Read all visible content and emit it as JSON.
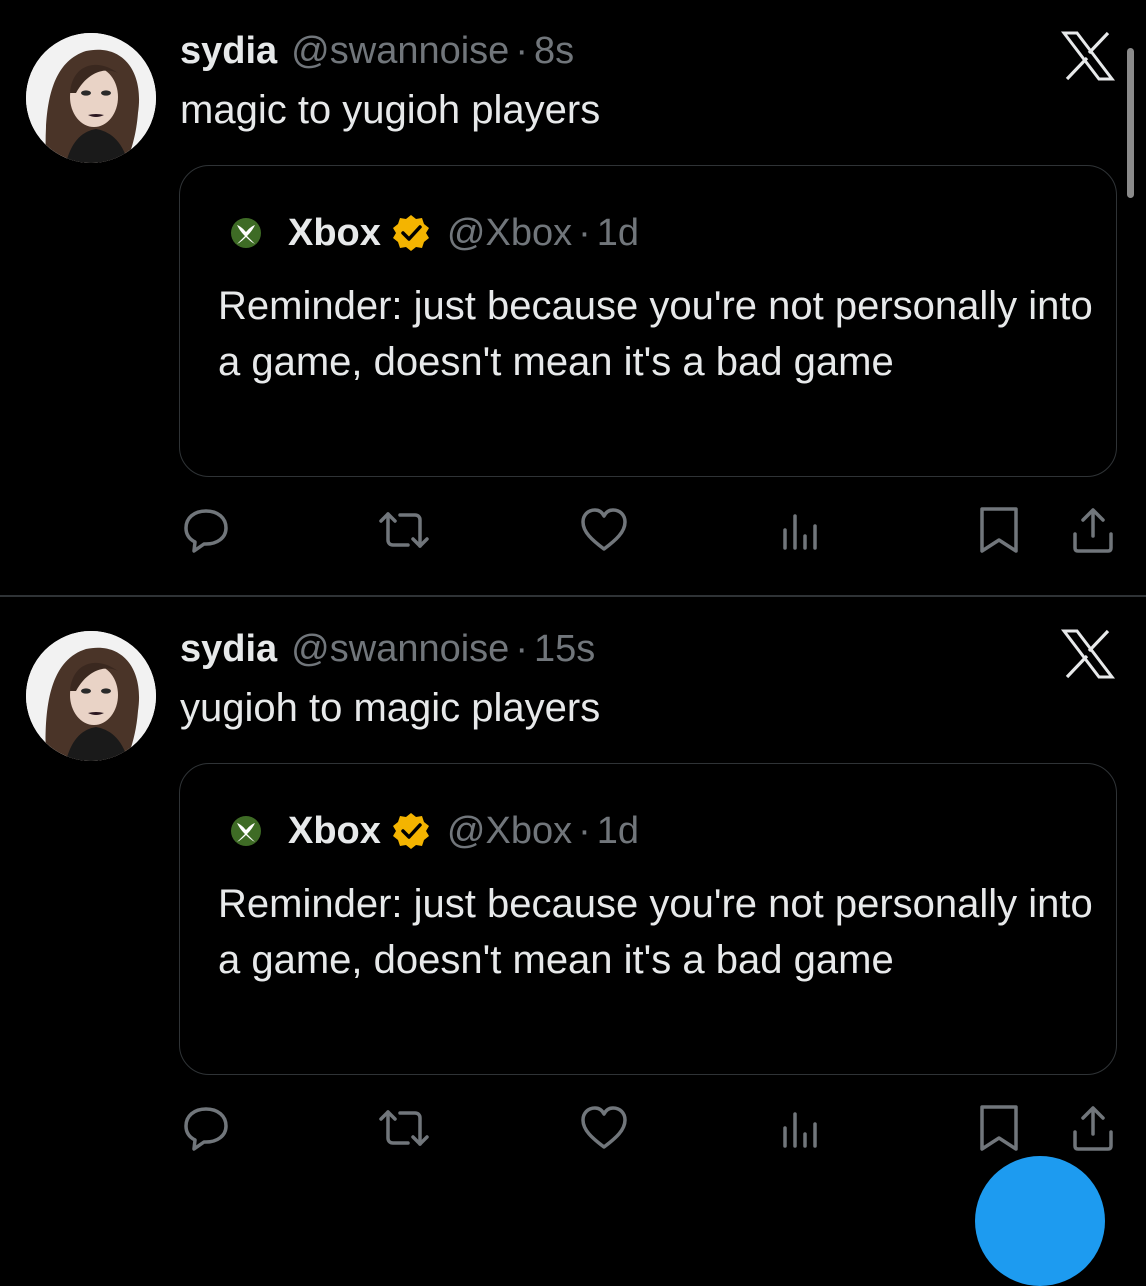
{
  "theme": {
    "background": "#000000",
    "text": "#e7e9ea",
    "secondary": "#71767b",
    "border": "#2f3336",
    "accent": "#1d9bf0",
    "verified_gold": "#f4b400",
    "xbox_green": "#107c10"
  },
  "posts": [
    {
      "author": {
        "name": "sydia",
        "handle": "@swannoise",
        "avatar_icon": "profile-photo"
      },
      "separator": "·",
      "time": "8s",
      "text": "magic to yugioh players",
      "close_icon": "x-logo-icon",
      "quote": {
        "author": {
          "name": "Xbox",
          "handle": "@Xbox",
          "avatar_icon": "xbox-logo-icon",
          "verified_icon": "verified-gold-badge-icon"
        },
        "separator": "·",
        "time": "1d",
        "text": "Reminder: just because you're not personally into a game, doesn't mean it's a bad game"
      },
      "actions": [
        "reply-icon",
        "repost-icon",
        "like-icon",
        "views-icon",
        "bookmark-icon",
        "share-icon"
      ]
    },
    {
      "author": {
        "name": "sydia",
        "handle": "@swannoise",
        "avatar_icon": "profile-photo"
      },
      "separator": "·",
      "time": "15s",
      "text": "yugioh to magic players",
      "close_icon": "x-logo-icon",
      "quote": {
        "author": {
          "name": "Xbox",
          "handle": "@Xbox",
          "avatar_icon": "xbox-logo-icon",
          "verified_icon": "verified-gold-badge-icon"
        },
        "separator": "·",
        "time": "1d",
        "text": "Reminder: just because you're not personally into a game, doesn't mean it's a bad game"
      },
      "actions": [
        "reply-icon",
        "repost-icon",
        "like-icon",
        "views-icon",
        "bookmark-icon",
        "share-icon"
      ]
    }
  ]
}
